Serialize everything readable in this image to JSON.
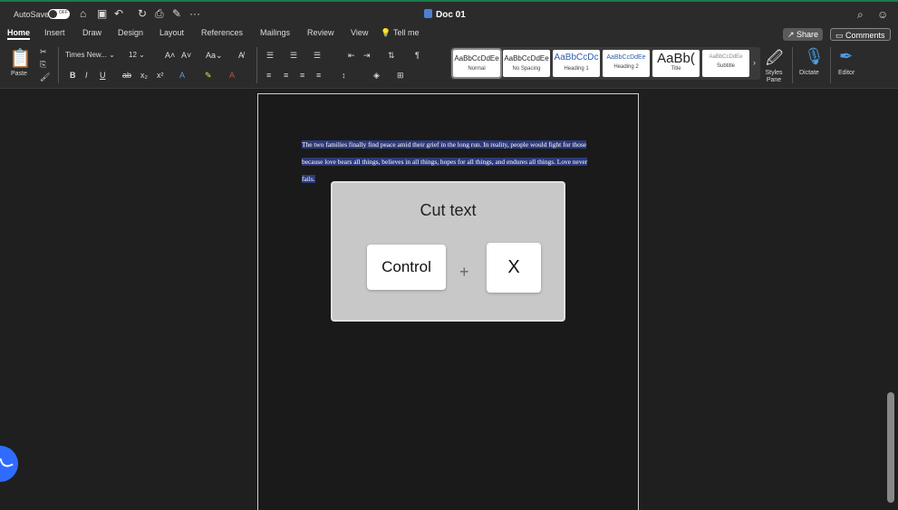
{
  "titlebar": {
    "autosave_label": "AutoSave",
    "autosave_state": "OFF",
    "doc_title": "Doc 01",
    "more": "···"
  },
  "tabs": [
    "Home",
    "Insert",
    "Draw",
    "Design",
    "Layout",
    "References",
    "Mailings",
    "Review",
    "View"
  ],
  "tell_me": "Tell me",
  "share_label": "Share",
  "comments_label": "Comments",
  "ribbon": {
    "paste_label": "Paste",
    "font_name": "Times New...",
    "font_size": "12",
    "styles": [
      {
        "sample": "AaBbCcDdEe",
        "name": "Normal"
      },
      {
        "sample": "AaBbCcDdEe",
        "name": "No Spacing"
      },
      {
        "sample": "AaBbCcDc",
        "name": "Heading 1"
      },
      {
        "sample": "AaBbCcDdEe",
        "name": "Heading 2"
      },
      {
        "sample": "AaBb(",
        "name": "Title"
      },
      {
        "sample": "AaBbCcDdEe",
        "name": "Subtitle"
      }
    ],
    "styles_pane_label": "Styles Pane",
    "dictate_label": "Dictate",
    "editor_label": "Editor"
  },
  "document": {
    "paragraph": "The two families finally find peace amid their grief in the long run. In reality, people would fight for those because love bears all things, believes in all things, hopes for all things, and endures all things. Love never fails."
  },
  "overlay": {
    "title": "Cut text",
    "key1": "Control",
    "plus": "+",
    "key2": "X"
  }
}
